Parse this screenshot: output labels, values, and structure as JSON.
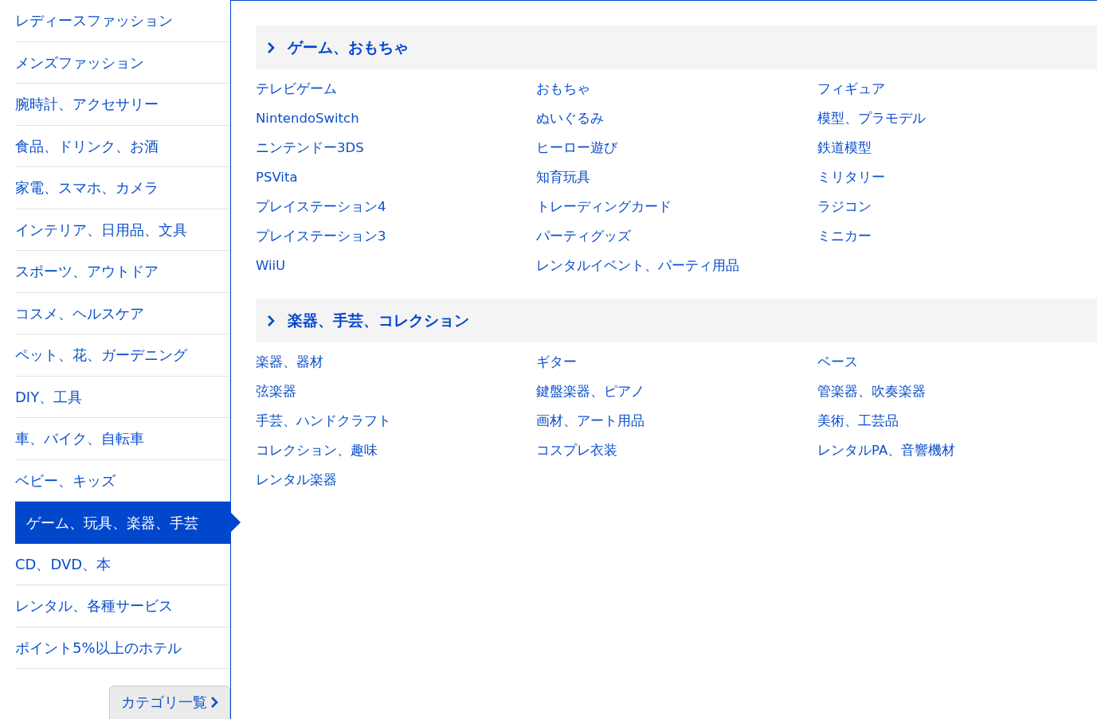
{
  "sidebar": {
    "items": [
      {
        "label": "レディースファッション",
        "selected": false
      },
      {
        "label": "メンズファッション",
        "selected": false
      },
      {
        "label": "腕時計、アクセサリー",
        "selected": false
      },
      {
        "label": "食品、ドリンク、お酒",
        "selected": false
      },
      {
        "label": "家電、スマホ、カメラ",
        "selected": false
      },
      {
        "label": "インテリア、日用品、文具",
        "selected": false
      },
      {
        "label": "スポーツ、アウトドア",
        "selected": false
      },
      {
        "label": "コスメ、ヘルスケア",
        "selected": false
      },
      {
        "label": "ペット、花、ガーデニング",
        "selected": false
      },
      {
        "label": "DIY、工具",
        "selected": false
      },
      {
        "label": "車、バイク、自転車",
        "selected": false
      },
      {
        "label": "ベビー、キッズ",
        "selected": false
      },
      {
        "label": "ゲーム、玩具、楽器、手芸",
        "selected": true
      },
      {
        "label": "CD、DVD、本",
        "selected": false
      },
      {
        "label": "レンタル、各種サービス",
        "selected": false
      },
      {
        "label": "ポイント5%以上のホテル",
        "selected": false
      }
    ],
    "all_button": "カテゴリ一覧"
  },
  "sections": [
    {
      "title": "ゲーム、おもちゃ",
      "links": [
        "テレビゲーム",
        "おもちゃ",
        "フィギュア",
        "NintendoSwitch",
        "ぬいぐるみ",
        "模型、プラモデル",
        "ニンテンドー3DS",
        "ヒーロー遊び",
        "鉄道模型",
        "PSVita",
        "知育玩具",
        "ミリタリー",
        "プレイステーション4",
        "トレーディングカード",
        "ラジコン",
        "プレイステーション3",
        "パーティグッズ",
        "ミニカー",
        "WiiU",
        "レンタルイベント、パーティ用品"
      ]
    },
    {
      "title": "楽器、手芸、コレクション",
      "links": [
        "楽器、器材",
        "ギター",
        "ベース",
        "弦楽器",
        "鍵盤楽器、ピアノ",
        "管楽器、吹奏楽器",
        "手芸、ハンドクラフト",
        "画材、アート用品",
        "美術、工芸品",
        "コレクション、趣味",
        "コスプレ衣装",
        "レンタルPA、音響機材",
        "レンタル楽器"
      ]
    }
  ]
}
